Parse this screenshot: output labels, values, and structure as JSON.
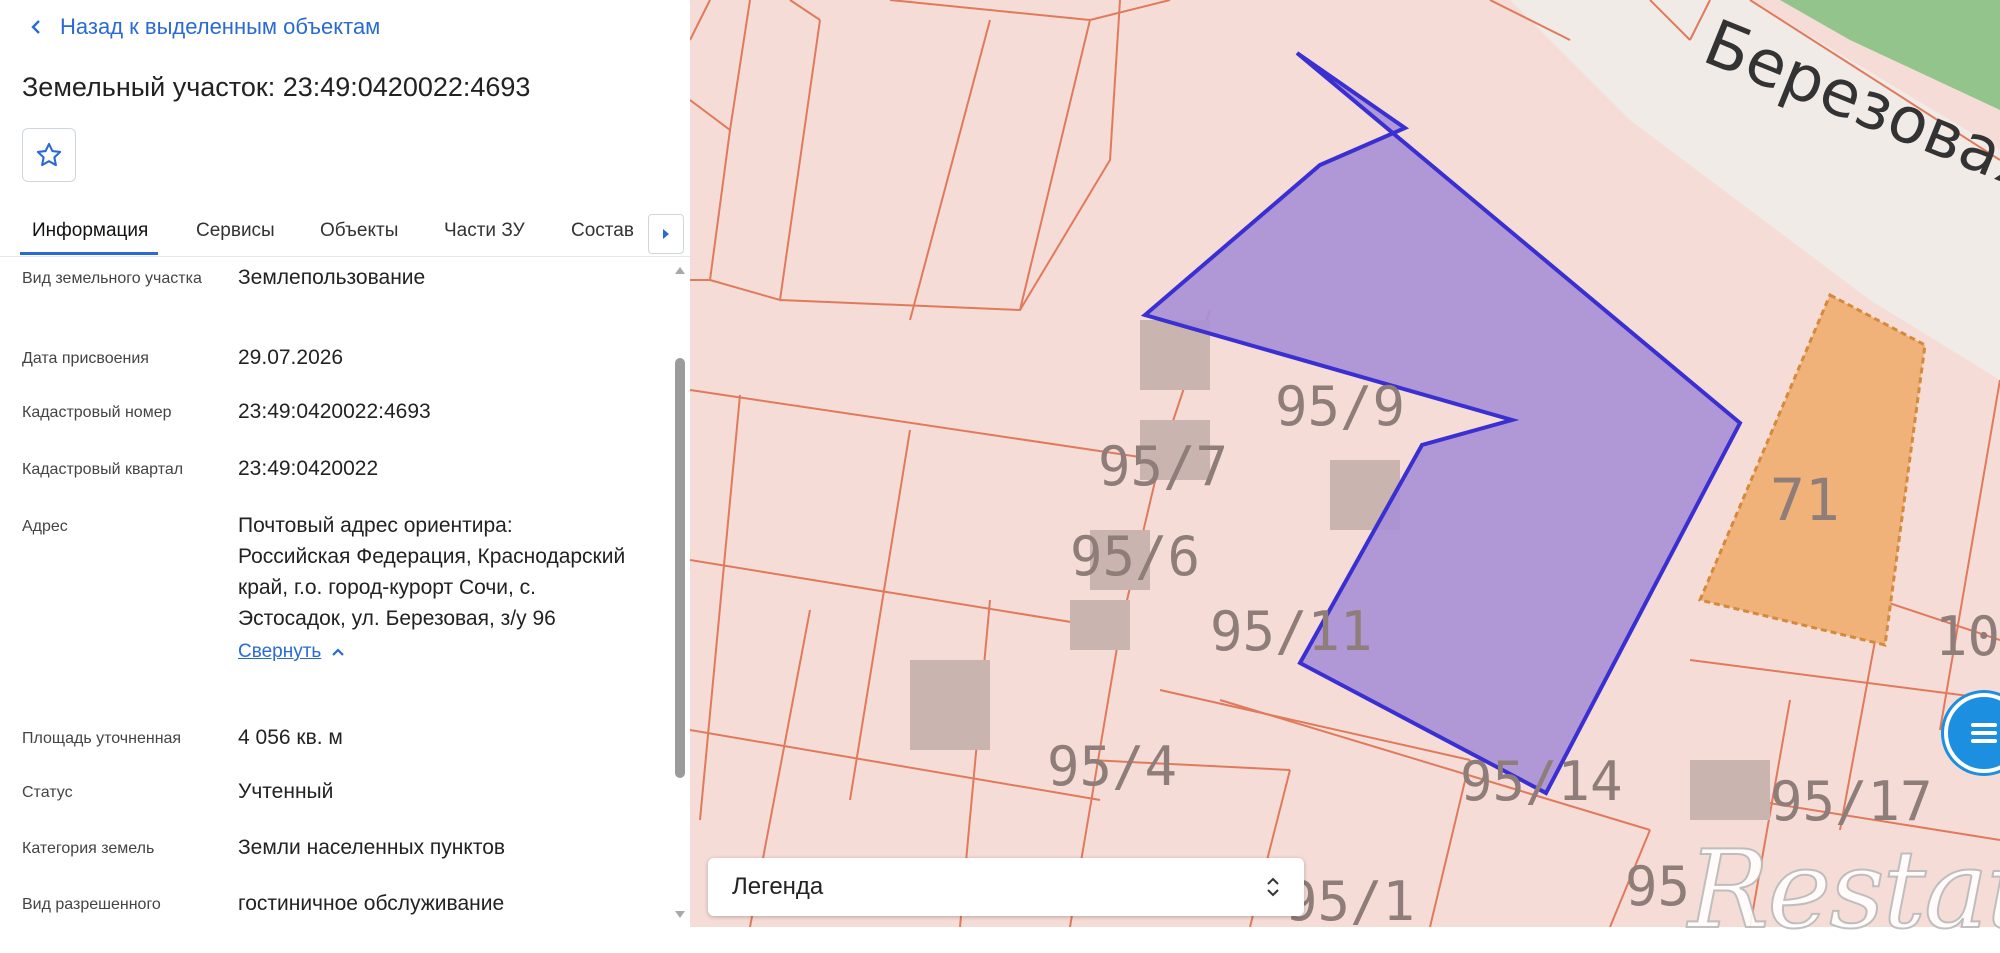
{
  "panel": {
    "back_label": "Назад к выделенным объектам",
    "title": "Земельный участок: 23:49:0420022:4693",
    "tabs": [
      {
        "label": "Информация",
        "active": true
      },
      {
        "label": "Сервисы"
      },
      {
        "label": "Объекты"
      },
      {
        "label": "Части ЗУ"
      },
      {
        "label": "Состав"
      }
    ],
    "rows": [
      {
        "label": "Вид земельного участка",
        "value": "Землепользование"
      },
      {
        "label": "Дата присвоения",
        "value": "29.07.2026"
      },
      {
        "label": "Кадастровый номер",
        "value": "23:49:0420022:4693"
      },
      {
        "label": "Кадастровый квартал",
        "value": "23:49:0420022"
      },
      {
        "label": "Адрес",
        "value": "Почтовый адрес ориентира: Российская Федерация, Краснодарский край, г.о. город-курорт Сочи, с. Эстосадок, ул. Березовая, з/у 96"
      },
      {
        "label": "Площадь уточненная",
        "value": "4 056 кв. м"
      },
      {
        "label": "Статус",
        "value": "Учтенный"
      },
      {
        "label": "Категория земель",
        "value": "Земли населенных пунктов"
      },
      {
        "label": "Вид разрешенного",
        "value": "гостиничное обслуживание"
      }
    ],
    "collapse_label": "Свернуть"
  },
  "map": {
    "street_label": "Березовая у",
    "parcel_labels": [
      "95/9",
      "95/7",
      "95/6",
      "95/11",
      "95/4",
      "95/14",
      "95/17",
      "95/1",
      "95",
      "71",
      "10"
    ],
    "legend_label": "Легенда",
    "watermark": "Restate",
    "colors": {
      "selected_fill": "#a98fd6",
      "selected_stroke": "#3a2fd0",
      "parcel_line": "#e07a5c",
      "orange_parcel": "#f0b278",
      "green_area": "#93c48b"
    }
  }
}
